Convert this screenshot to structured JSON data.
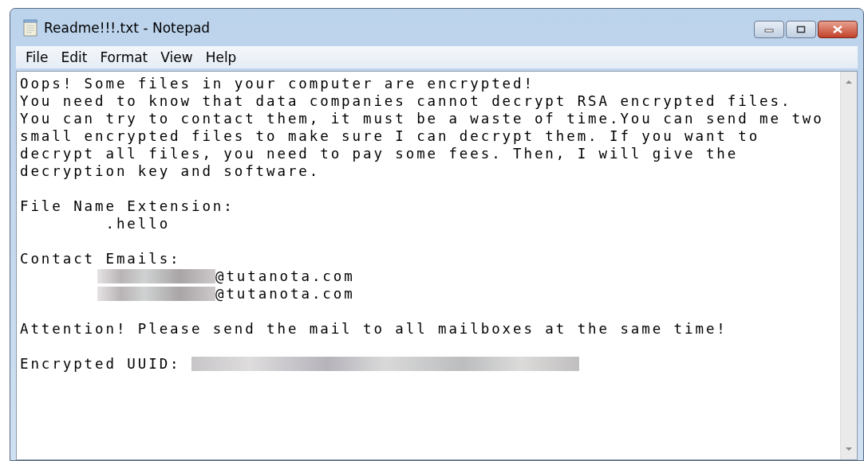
{
  "window": {
    "title": "Readme!!!.txt - Notepad"
  },
  "menu": [
    "File",
    "Edit",
    "Format",
    "View",
    "Help"
  ],
  "document": {
    "lines": [
      {
        "kind": "text",
        "text": "Oops! Some files in your computer are encrypted!"
      },
      {
        "kind": "text",
        "text": "You need to know that data companies cannot decrypt RSA encrypted files."
      },
      {
        "kind": "text",
        "text": "You can try to contact them, it must be a waste of time.You can send me two"
      },
      {
        "kind": "text",
        "text": "small encrypted files to make sure I can decrypt them. If you want to"
      },
      {
        "kind": "text",
        "text": "decrypt all files, you need to pay some fees. Then, I will give the"
      },
      {
        "kind": "text",
        "text": "decryption key and software."
      },
      {
        "kind": "blank"
      },
      {
        "kind": "text",
        "text": "File Name Extension:"
      },
      {
        "kind": "text",
        "text": "\t.hello"
      },
      {
        "kind": "blank"
      },
      {
        "kind": "text",
        "text": "Contact Emails:"
      },
      {
        "kind": "redacted_before",
        "text": "@tutanota.com"
      },
      {
        "kind": "redacted_before",
        "text": "@tutanota.com"
      },
      {
        "kind": "blank"
      },
      {
        "kind": "text",
        "text": "Attention! Please send the mail to all mailboxes at the same time!"
      },
      {
        "kind": "blank"
      },
      {
        "kind": "redacted_after",
        "text": "Encrypted UUID: "
      }
    ]
  }
}
